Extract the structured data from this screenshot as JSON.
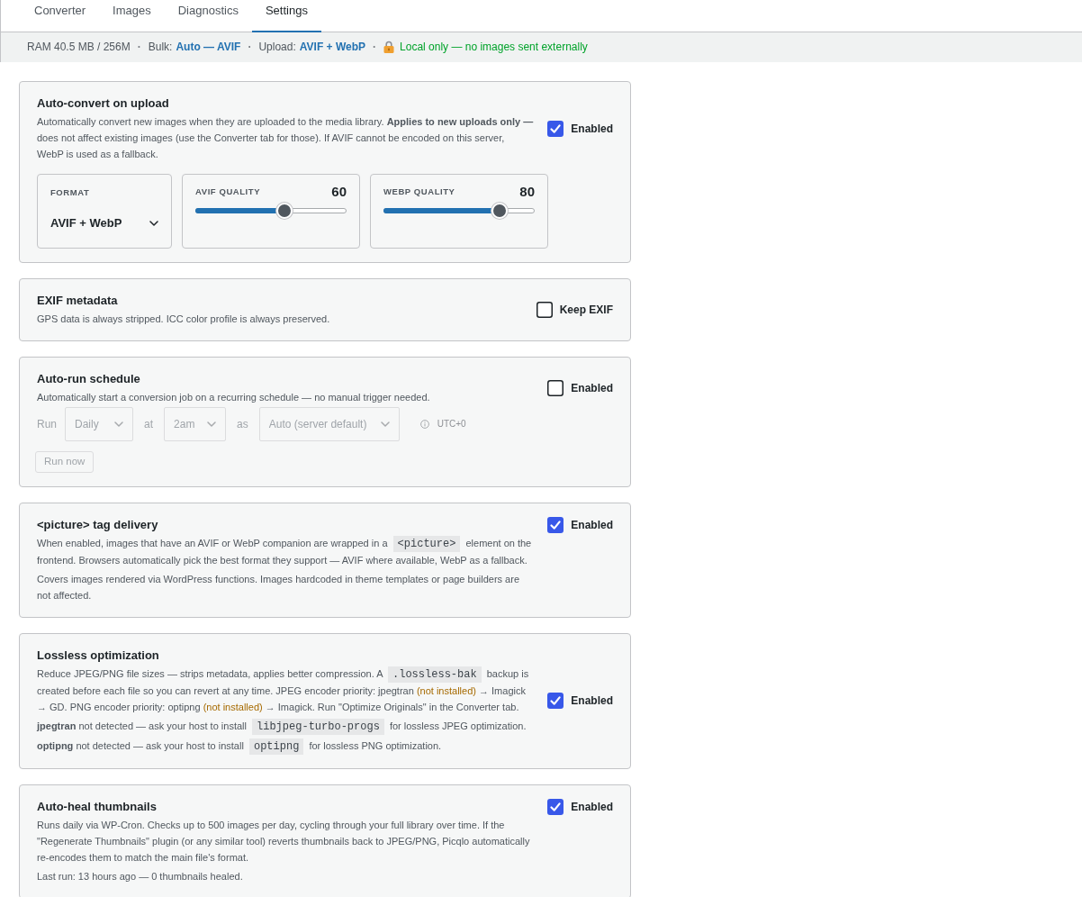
{
  "tabs": [
    {
      "label": "Converter",
      "selected": false
    },
    {
      "label": "Images",
      "selected": false
    },
    {
      "label": "Diagnostics",
      "selected": false
    },
    {
      "label": "Settings",
      "selected": true
    }
  ],
  "status_bar": [
    {
      "kind": "text",
      "text": "RAM 40.5 MB / 256M"
    },
    {
      "kind": "separator",
      "text": "·"
    },
    {
      "kind": "pair",
      "label": "Bulk:",
      "value": "Auto — AVIF"
    },
    {
      "kind": "separator",
      "text": "·"
    },
    {
      "kind": "pair",
      "label": "Upload:",
      "value": "AVIF + WebP"
    },
    {
      "kind": "separator",
      "text": "·"
    },
    {
      "kind": "secure",
      "text": "Local only — no images sent externally"
    }
  ],
  "cards": [
    {
      "kind": "converter",
      "title": "Auto-convert on upload",
      "paragraphs": [
        [
          {
            "kind": "text",
            "text": "Automatically convert new images when they are uploaded to the media library. **Applies to new uploads only —** does not affect existing images (use the Converter tab for those). If AVIF cannot be encoded on this server, WebP is used as a fallback."
          }
        ]
      ],
      "toggle": {
        "label": "Enabled",
        "checked": true
      },
      "format": {
        "label": "FORMAT",
        "value": "AVIF + WebP"
      },
      "sliders": [
        {
          "label": "AVIF QUALITY",
          "reading": "60",
          "level": 0.6
        },
        {
          "label": "WEBP QUALITY",
          "reading": "80",
          "level": 0.8
        }
      ]
    },
    {
      "kind": "plain",
      "title": "EXIF metadata",
      "paragraphs": [
        [
          {
            "kind": "text",
            "text": "GPS data is always stripped. ICC color profile is always preserved."
          }
        ]
      ],
      "toggle": {
        "label": "Keep EXIF",
        "checked": false
      }
    },
    {
      "kind": "schedule",
      "title": "Auto-run schedule",
      "paragraphs": [
        [
          {
            "kind": "text",
            "text": "Automatically start a conversion job on a recurring schedule — no manual trigger needed."
          }
        ]
      ],
      "toggle": {
        "label": "Enabled",
        "checked": false
      },
      "schedule": {
        "disabled": true,
        "fields": [
          {
            "kind": "label",
            "text": "Run"
          },
          {
            "kind": "select",
            "value": "Daily"
          },
          {
            "kind": "label",
            "text": "at"
          },
          {
            "kind": "select",
            "value": "2am"
          },
          {
            "kind": "label",
            "text": "as"
          },
          {
            "kind": "select",
            "value": "Auto (server default)"
          },
          {
            "kind": "timezone",
            "text": "UTC+0"
          }
        ],
        "button": "Run now"
      }
    },
    {
      "kind": "plain",
      "title": "<picture> tag delivery",
      "paragraphs": [
        [
          {
            "kind": "text",
            "text": "When enabled, images that have an AVIF or WebP companion are wrapped in a "
          },
          {
            "kind": "code",
            "text": "<picture>"
          },
          {
            "kind": "text",
            "text": " element on the frontend. Browsers automatically pick the best format they support — AVIF where available, WebP as a fallback."
          }
        ],
        [
          {
            "kind": "text",
            "text": "Covers images rendered via WordPress functions. Images hardcoded in theme templates or page builders are not affected."
          }
        ]
      ],
      "toggle": {
        "label": "Enabled",
        "checked": true
      }
    },
    {
      "kind": "plain",
      "title": "Lossless optimization",
      "paragraphs": [
        [
          {
            "kind": "text",
            "text": "Reduce JPEG/PNG file sizes — strips metadata, applies better compression. A "
          },
          {
            "kind": "code",
            "text": ".lossless-bak"
          },
          {
            "kind": "text",
            "text": " backup is created before each file so you can revert at any time. JPEG encoder priority: jpegtran "
          },
          {
            "kind": "warning",
            "text": "(not installed)"
          },
          {
            "kind": "text",
            "text": " → Imagick → GD. PNG encoder priority: optipng "
          },
          {
            "kind": "warning",
            "text": "(not installed)"
          },
          {
            "kind": "text",
            "text": " → Imagick. Run \"Optimize Originals\" in the Converter tab."
          }
        ],
        [
          {
            "kind": "text",
            "text": "**jpegtran** not detected — ask your host to install "
          },
          {
            "kind": "code",
            "text": "libjpeg-turbo-progs"
          },
          {
            "kind": "text",
            "text": " for lossless JPEG optimization."
          }
        ],
        [
          {
            "kind": "text",
            "text": "**optipng** not detected — ask your host to install "
          },
          {
            "kind": "code",
            "text": "optipng"
          },
          {
            "kind": "text",
            "text": " for lossless PNG optimization."
          }
        ]
      ],
      "toggle": {
        "label": "Enabled",
        "checked": true
      }
    },
    {
      "kind": "plain",
      "title": "Auto-heal thumbnails",
      "paragraphs": [
        [
          {
            "kind": "text",
            "text": "Runs daily via WP-Cron. Checks up to 500 images per day, cycling through your full library over time. If the \"Regenerate Thumbnails\" plugin (or any similar tool) reverts thumbnails back to JPEG/PNG, Picqlo automatically re-encodes them to match the main file's format."
          }
        ],
        [
          {
            "kind": "text",
            "text": "Last run: 13 hours ago — 0 thumbnails healed."
          }
        ]
      ],
      "toggle": {
        "label": "Enabled",
        "checked": true
      }
    }
  ]
}
